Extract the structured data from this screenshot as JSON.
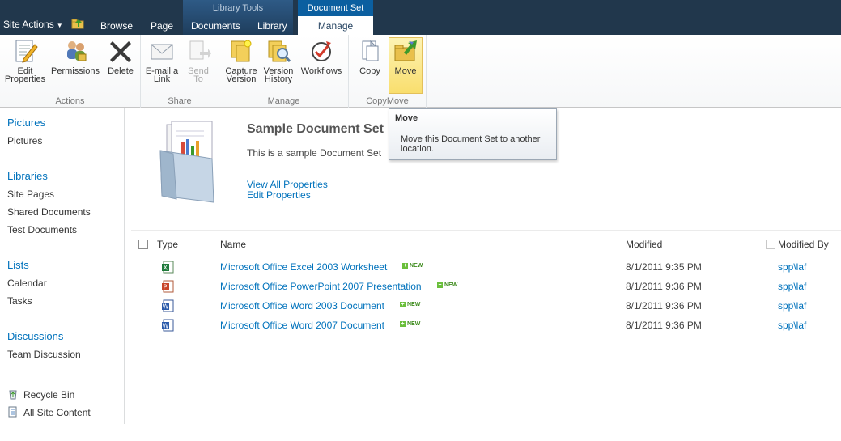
{
  "topbar": {
    "site_actions": "Site Actions",
    "tabs": {
      "browse": "Browse",
      "page": "Page",
      "documents": "Documents",
      "library": "Library",
      "manage": "Manage"
    },
    "context_groups": {
      "library_tools": "Library Tools",
      "document_set": "Document Set"
    }
  },
  "ribbon": {
    "groups": {
      "actions": "Actions",
      "share": "Share",
      "manage": "Manage",
      "copymove": "CopyMove"
    },
    "buttons": {
      "edit_properties": [
        "Edit",
        "Properties"
      ],
      "permissions": "Permissions",
      "delete": "Delete",
      "email_link": [
        "E-mail a",
        "Link"
      ],
      "send_to": [
        "Send",
        "To"
      ],
      "capture_version": [
        "Capture",
        "Version"
      ],
      "version_history": [
        "Version",
        "History"
      ],
      "workflows": "Workflows",
      "copy": "Copy",
      "move": "Move"
    }
  },
  "tooltip": {
    "title": "Move",
    "body": "Move this Document Set to another location."
  },
  "leftnav": {
    "sections": [
      {
        "heading": "Pictures",
        "items": [
          "Pictures"
        ]
      },
      {
        "heading": "Libraries",
        "items": [
          "Site Pages",
          "Shared Documents",
          "Test Documents"
        ]
      },
      {
        "heading": "Lists",
        "items": [
          "Calendar",
          "Tasks"
        ]
      },
      {
        "heading": "Discussions",
        "items": [
          "Team Discussion"
        ]
      }
    ],
    "utility": {
      "recycle_bin": "Recycle Bin",
      "all_site_content": "All Site Content"
    }
  },
  "docset": {
    "title": "Sample Document Set",
    "description": "This is a sample Document Set",
    "view_all_properties": "View All Properties",
    "edit_properties": "Edit Properties"
  },
  "table": {
    "headers": {
      "type": "Type",
      "name": "Name",
      "modified": "Modified",
      "modified_by": "Modified By"
    },
    "new_label": "NEW",
    "rows": [
      {
        "type_icon": "excel-icon",
        "name": "Microsoft Office Excel 2003 Worksheet",
        "modified": "8/1/2011 9:35 PM",
        "modified_by": "spp\\laf"
      },
      {
        "type_icon": "powerpoint-icon",
        "name": "Microsoft Office PowerPoint 2007 Presentation",
        "modified": "8/1/2011 9:36 PM",
        "modified_by": "spp\\laf"
      },
      {
        "type_icon": "word-icon",
        "name": "Microsoft Office Word 2003 Document",
        "modified": "8/1/2011 9:36 PM",
        "modified_by": "spp\\laf"
      },
      {
        "type_icon": "word-icon",
        "name": "Microsoft Office Word 2007 Document",
        "modified": "8/1/2011 9:36 PM",
        "modified_by": "spp\\laf"
      }
    ]
  },
  "colors": {
    "topbar": "#21374c",
    "link": "#0072bc",
    "active_button": "#f9de6d"
  }
}
